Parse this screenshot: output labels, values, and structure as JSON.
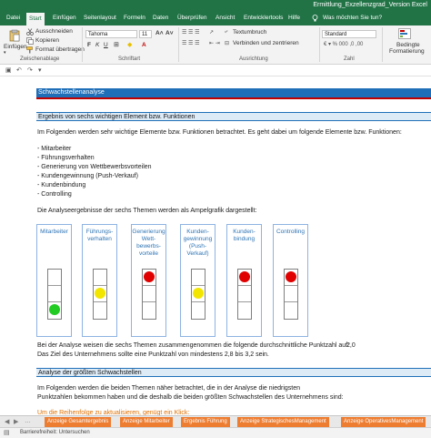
{
  "window": {
    "title": "Ermittlung_Exzellenzgrad_Version Excel"
  },
  "ribbon_tabs": [
    "Datei",
    "Start",
    "Einfügen",
    "Seitenlayout",
    "Formeln",
    "Daten",
    "Überprüfen",
    "Ansicht",
    "Entwicklertools",
    "Hilfe"
  ],
  "active_tab": "Start",
  "tell_me": "Was möchten Sie tun?",
  "ribbon": {
    "paste": "Einfügen",
    "cut": "Ausschneiden",
    "copy": "Kopieren",
    "format_painter": "Format übertragen",
    "clipboard_label": "Zwischenablage",
    "font_name": "Tahoma",
    "font_size": "11",
    "font_label": "Schriftart",
    "wrap_text": "Textumbruch",
    "merge_center": "Verbinden und zentrieren",
    "alignment_label": "Ausrichtung",
    "number_format": "Standard",
    "number_label": "Zahl",
    "cond_format_1": "Bedingte",
    "cond_format_2": "Formatierung"
  },
  "sheet": {
    "title": "Schwachstellenanalyse",
    "section1": "Ergebnis von sechs wichtigen Element bzw. Funktionen",
    "intro": "Im Folgenden werden sehr wichtige Elemente bzw. Funktionen betrachtet. Es geht dabei um folgende Elemente bzw. Funktionen:",
    "elements": [
      "- Mitarbeiter",
      "- Führungsverhalten",
      "- Generierung von Wettbewerbsvorteilen",
      "- Kundengewinnung (Push-Verkauf)",
      "- Kundenbindung",
      "- Controlling"
    ],
    "traffic_intro": "Die Analyseergebnisse der sechs Themen werden als Ampelgrafik dargestellt:",
    "themes": [
      {
        "title": "Mitarbeiter",
        "light": "green",
        "lines": [
          "Mitarbeiter"
        ]
      },
      {
        "title": "Führungsverhalten",
        "light": "yellow",
        "lines": [
          "Führungs-",
          "verhalten"
        ]
      },
      {
        "title": "Generierung Wettbewerbsvorteile",
        "light": "red",
        "lines": [
          "Generierung",
          "Wett-",
          "bewerbs-",
          "vorteile"
        ]
      },
      {
        "title": "Kundengewinnung (Push-Verkauf)",
        "light": "yellow",
        "lines": [
          "Kunden-",
          "gewinnung",
          "(Push-",
          "Verkauf)"
        ]
      },
      {
        "title": "Kundenbindung",
        "light": "red",
        "lines": [
          "Kunden-",
          "bindung"
        ]
      },
      {
        "title": "Controlling",
        "light": "red",
        "lines": [
          "Controlling"
        ]
      }
    ],
    "avg_text": "Bei der Analyse weisen die sechs Themen zusammengenommen die folgende durchschnittliche Punktzahl auf:",
    "avg_value": "2,0",
    "goal_text": "Das Ziel des Unternehmens sollte eine Punktzahl von mindestens 2,8 bis 3,2 sein.",
    "section2": "Analyse der größten Schwachstellen",
    "weak_text_1": "Im Folgenden werden die beiden Themen näher betrachtet, die in der Analyse die niedrigsten",
    "weak_text_2": "Punktzahlen bekommen haben und die deshalb die beiden größten Schwachstellen des Unternehmens sind:",
    "refresh_hint": "Um die Reihenfolge zu aktualisieren, genügt ein Klick:"
  },
  "sheet_tabs": [
    "Anzeige Gesamtergebnis",
    "Anzeige Mitarbeiter",
    "Ergebnis Führung",
    "Anzeige StrategischesManagement",
    "Anzeige OperativesManagement"
  ],
  "status": {
    "accessibility": "Barrierefreiheit: Untersuchen"
  },
  "colors": {
    "excel_green": "#217346",
    "header_blue": "#1f6fb8",
    "tab_orange": "#ed7d31",
    "green": "#22cc22",
    "yellow": "#f2e600",
    "red": "#e00000"
  }
}
